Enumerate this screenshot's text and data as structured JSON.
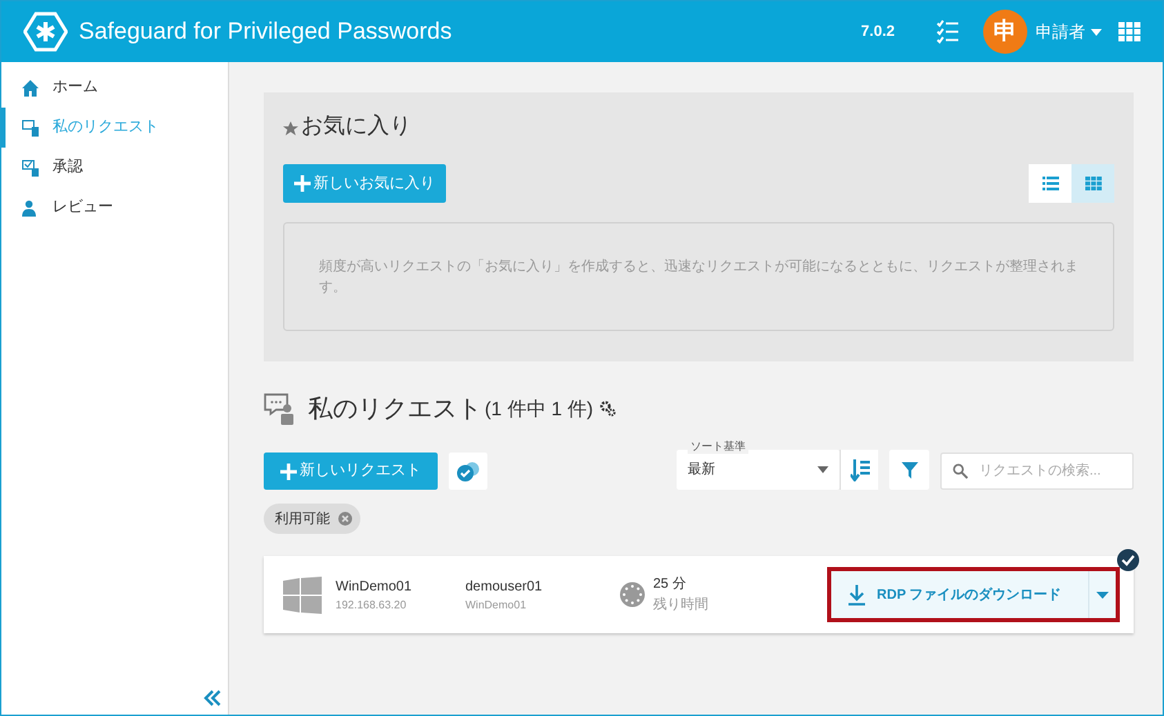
{
  "header": {
    "title": "Safeguard for Privileged Passwords",
    "version": "7.0.2",
    "avatar": "申",
    "user": "申請者"
  },
  "sidebar": {
    "items": [
      {
        "kind": "home",
        "label": "ホーム",
        "selected": false
      },
      {
        "kind": "request",
        "label": "私のリクエスト",
        "selected": true
      },
      {
        "kind": "approve",
        "label": "承認",
        "selected": false
      },
      {
        "kind": "review",
        "label": "レビュー",
        "selected": false
      }
    ]
  },
  "favorites": {
    "title": "お気に入り",
    "new_button": "新しいお気に入り",
    "views": [
      {
        "kind": "list",
        "selected": false
      },
      {
        "kind": "grid",
        "selected": true
      }
    ],
    "empty_message": "頻度が高いリクエストの「お気に入り」を作成すると、迅速なリクエストが可能になるとともに、リクエストが整理されます。"
  },
  "requests": {
    "title": "私のリクエスト",
    "count": "(1 件中 1 件)",
    "new_button": "新しいリクエスト",
    "sort": {
      "label": "ソート基準",
      "value": "最新"
    },
    "search": {
      "placeholder": "リクエストの検索..."
    },
    "filters": [
      {
        "label": "利用可能"
      }
    ],
    "rows": [
      {
        "asset": "WinDemo01",
        "address": "192.168.63.20",
        "account": "demouser01",
        "account_asset": "WinDemo01",
        "time": "25 分",
        "time_label": "残り時間",
        "action": "RDP ファイルのダウンロード",
        "highlighted": true,
        "checked": true
      }
    ]
  }
}
